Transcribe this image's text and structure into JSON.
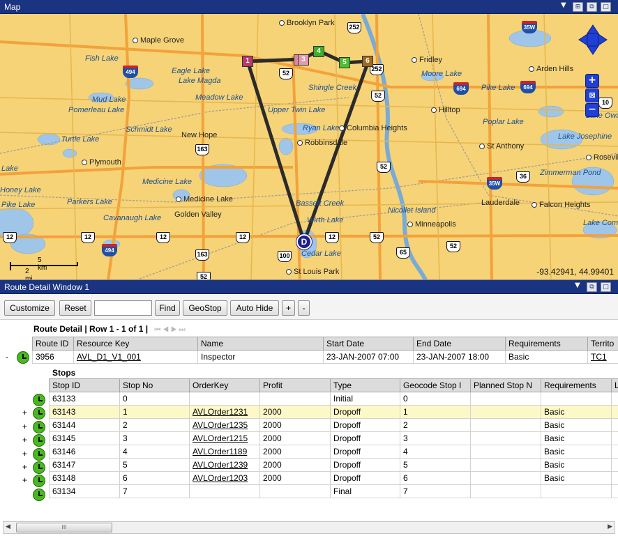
{
  "map_window": {
    "title": "Map",
    "coords": "-93.42941, 44.99401",
    "scale": {
      "km": "5 km",
      "mi": "2 mi"
    },
    "places": [
      {
        "name": "Brooklyn Park",
        "type": "city"
      },
      {
        "name": "Maple Grove",
        "type": "city"
      },
      {
        "name": "Fridley",
        "type": "city"
      },
      {
        "name": "Arden Hills",
        "type": "city"
      },
      {
        "name": "Hilltop",
        "type": "city"
      },
      {
        "name": "Columbia Heights",
        "type": "city"
      },
      {
        "name": "New Hope",
        "type": "city"
      },
      {
        "name": "Robbinsdale",
        "type": "city"
      },
      {
        "name": "St Anthony",
        "type": "city"
      },
      {
        "name": "Plymouth",
        "type": "city"
      },
      {
        "name": "Roseville",
        "type": "city"
      },
      {
        "name": "Medicine Lake",
        "type": "city"
      },
      {
        "name": "Golden Valley",
        "type": "city"
      },
      {
        "name": "Lauderdale",
        "type": "city"
      },
      {
        "name": "Falcon Heights",
        "type": "city"
      },
      {
        "name": "Minneapolis",
        "type": "city"
      },
      {
        "name": "St Louis Park",
        "type": "city"
      },
      {
        "name": "Fish Lake",
        "type": "water"
      },
      {
        "name": "Eagle Lake",
        "type": "water"
      },
      {
        "name": "Lake Magda",
        "type": "water"
      },
      {
        "name": "Meadow Lake",
        "type": "water"
      },
      {
        "name": "Mud Lake",
        "type": "water"
      },
      {
        "name": "Pomerleau Lake",
        "type": "water"
      },
      {
        "name": "Schmidt Lake",
        "type": "water"
      },
      {
        "name": "Turtle Lake",
        "type": "water"
      },
      {
        "name": "Upper Twin Lake",
        "type": "water"
      },
      {
        "name": "Ryan Lake",
        "type": "water"
      },
      {
        "name": "Shingle Creek",
        "type": "water"
      },
      {
        "name": "Moore Lake",
        "type": "water"
      },
      {
        "name": "Pike Lake",
        "type": "water"
      },
      {
        "name": "Poplar Lake",
        "type": "water"
      },
      {
        "name": "Lake Josephine",
        "type": "water"
      },
      {
        "name": "Zimmerman Pond",
        "type": "water"
      },
      {
        "name": "Medicine Lake",
        "type": "water"
      },
      {
        "name": "Parkers Lake",
        "type": "water"
      },
      {
        "name": "Cavanaugh Lake",
        "type": "water"
      },
      {
        "name": "Bassett Creek",
        "type": "water"
      },
      {
        "name": "Nicollet Island",
        "type": "water"
      },
      {
        "name": "Wirth Lake",
        "type": "water"
      },
      {
        "name": "Cedar Lake",
        "type": "water"
      },
      {
        "name": "Lake Owasso",
        "type": "water"
      },
      {
        "name": "Lake Como",
        "type": "water"
      },
      {
        "name": "Lake",
        "type": "water"
      },
      {
        "name": "Honey Lake",
        "type": "water"
      },
      {
        "name": "Pike Lake",
        "type": "water"
      }
    ],
    "shields": [
      "252",
      "52",
      "52",
      "52",
      "52",
      "163",
      "163",
      "12",
      "12",
      "12",
      "12",
      "12",
      "100",
      "65",
      "52",
      "36",
      "10",
      "52",
      "252"
    ],
    "interstates": [
      "494",
      "35W",
      "694",
      "694",
      "35W",
      "494"
    ],
    "stops": [
      {
        "label": "1",
        "color": "#b83a6a"
      },
      {
        "label": "2",
        "color": "#d98aa0"
      },
      {
        "label": "3",
        "color": "#e49ab0"
      },
      {
        "label": "4",
        "color": "#3fae2a"
      },
      {
        "label": "5",
        "color": "#4fbf2f"
      },
      {
        "label": "6",
        "color": "#a06a1e"
      }
    ],
    "depot_label": "D"
  },
  "route_window": {
    "title": "Route Detail Window 1",
    "toolbar": {
      "customize": "Customize",
      "reset": "Reset",
      "search_value": "",
      "find": "Find",
      "geostop": "GeoStop",
      "autohide": "Auto Hide",
      "plus": "+",
      "minus": "-"
    },
    "route_detail_label": "Route Detail | Row 1 - 1 of 1 |",
    "pager_icons": "⏮ ◀ ▶ ⏭",
    "route_columns": [
      "Route ID",
      "Resource Key",
      "Name",
      "Start Date",
      "End Date",
      "Requirements",
      "Territo"
    ],
    "route_row": {
      "expander": "-",
      "route_id": "3956",
      "resource_key": "AVL_D1_V1_001",
      "name": "Inspector",
      "start_date": "23-JAN-2007 07:00",
      "end_date": "23-JAN-2007 18:00",
      "requirements": "Basic",
      "territory": "TC1"
    },
    "stops_label": "Stops",
    "stop_columns": [
      "Stop ID",
      "Stop No",
      "OrderKey",
      "Profit",
      "Type",
      "Geocode Stop I",
      "Planned Stop N",
      "Requirements",
      "L"
    ],
    "stop_rows": [
      {
        "expander": "",
        "stop_id": "63133",
        "stop_no": "0",
        "order_key": "",
        "profit": "",
        "type": "Initial",
        "geocode": "0",
        "planned": "",
        "requirements": ""
      },
      {
        "expander": "+",
        "stop_id": "63143",
        "stop_no": "1",
        "order_key": "AVLOrder1231",
        "profit": "2000",
        "type": "Dropoff",
        "geocode": "1",
        "planned": "",
        "requirements": "Basic"
      },
      {
        "expander": "+",
        "stop_id": "63144",
        "stop_no": "2",
        "order_key": "AVLOrder1235",
        "profit": "2000",
        "type": "Dropoff",
        "geocode": "2",
        "planned": "",
        "requirements": "Basic"
      },
      {
        "expander": "+",
        "stop_id": "63145",
        "stop_no": "3",
        "order_key": "AVLOrder1215",
        "profit": "2000",
        "type": "Dropoff",
        "geocode": "3",
        "planned": "",
        "requirements": "Basic"
      },
      {
        "expander": "+",
        "stop_id": "63146",
        "stop_no": "4",
        "order_key": "AVLOrder1189",
        "profit": "2000",
        "type": "Dropoff",
        "geocode": "4",
        "planned": "",
        "requirements": "Basic"
      },
      {
        "expander": "+",
        "stop_id": "63147",
        "stop_no": "5",
        "order_key": "AVLOrder1239",
        "profit": "2000",
        "type": "Dropoff",
        "geocode": "5",
        "planned": "",
        "requirements": "Basic"
      },
      {
        "expander": "+",
        "stop_id": "63148",
        "stop_no": "6",
        "order_key": "AVLOrder1203",
        "profit": "2000",
        "type": "Dropoff",
        "geocode": "6",
        "planned": "",
        "requirements": "Basic"
      },
      {
        "expander": "",
        "stop_id": "63134",
        "stop_no": "7",
        "order_key": "",
        "profit": "",
        "type": "Final",
        "geocode": "7",
        "planned": "",
        "requirements": ""
      }
    ],
    "scroll_thumb_glyph": "III"
  },
  "icons": [
    "pin-icon",
    "restore-icon",
    "maximize-icon",
    "dropdown-arrow-icon",
    "clock-icon",
    "pan-control-icon",
    "zoom-in-icon",
    "zoom-out-icon",
    "zoom-extent-icon"
  ]
}
